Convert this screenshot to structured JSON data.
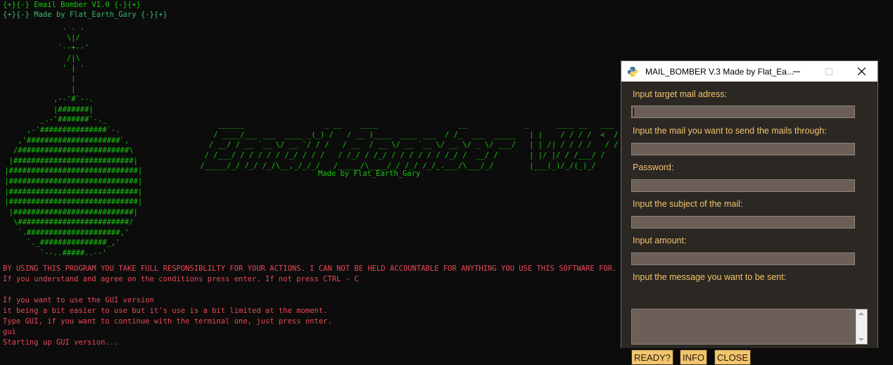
{
  "terminal": {
    "header1": "{+}{-} Email Bomber V1.0 {-}{+}",
    "header2": "{+}{-} Made by Flat_Earth_Gary {-}{+}",
    "bomb_art": "              . . .\n               \\|/\n             `--+--'\n               /|\\\n              ' | '\n                |\n                |\n            ,--'#`--.\n            |#######|\n         _.-'#######`-._\n      ,-'###############`-.\n    ,'#####################`,\n   /#########################\\\n  |###########################|\n |#############################|\n |#############################|\n |#############################|\n |#############################|\n  |###########################|\n   \\#########################/\n    `.#####################,'\n      `._###############_,'\n         `--..#####..--'",
    "logo_art": "     ______                  _ __    ____                  __             _      ____ __   ___\n    / ____/___ ___  ____ _(_) /   / __ )____  ____ ___  / /_  ___  _____   | |    / / / /  <  /\n   / __/ / __ `__ \\/ __ `/ / /   / __  / __ \\/ __ `__ \\/ __ \\/ _ \\/ ___/   | | /| / / / /   / / \n  / /___/ / / / / / /_/ / / /   / /_/ / /_/ / / / / / / /_/ /  __/ /       | |/ |/ / /___/ /  \n /_____/_/ /_/ /_/\\__,_/_/_/   /_____/\\____/_/ /_/ /_/_.___/\\___/_/        |___(_)/_/(_)_/   ",
    "credit": "Made by Flat_Earth_Gary",
    "warning": "BY USING THIS PROGRAM YOU TAKE FULL RESPONSIBLILTY FOR YOUR ACTIONS. I CAN NOT BE HELD ACCOUNTABLE FOR ANYTHING YOU USE THIS SOFTWARE FOR.",
    "agree": "If you understand and agree on the conditions press enter. If not press CTRL - C",
    "gui1": "If you want to use the GUI version",
    "gui2": "it being a bit easier to use but it's use is a bit limited at the moment.",
    "gui3": "Type GUI, if you want to continue with the terminal one, just press enter.",
    "input": "gui",
    "starting": "Starting up GUI version..."
  },
  "window": {
    "title": "MAIL_BOMBER V.3 Made by Flat_Ea...",
    "labels": {
      "target": "Input target mail adress:",
      "sender": "Input the mail you want to send the mails through:",
      "password": "Password:",
      "subject": "Input the subject of the mail:",
      "amount": "Input amount:",
      "message": "Input the message you want to be sent:"
    },
    "buttons": {
      "ready": "READY?",
      "info": "INFO",
      "close": "CLOSE"
    },
    "colors": {
      "accent": "#f2c46c",
      "field": "#6b5f57",
      "background": "#2b2723"
    }
  }
}
